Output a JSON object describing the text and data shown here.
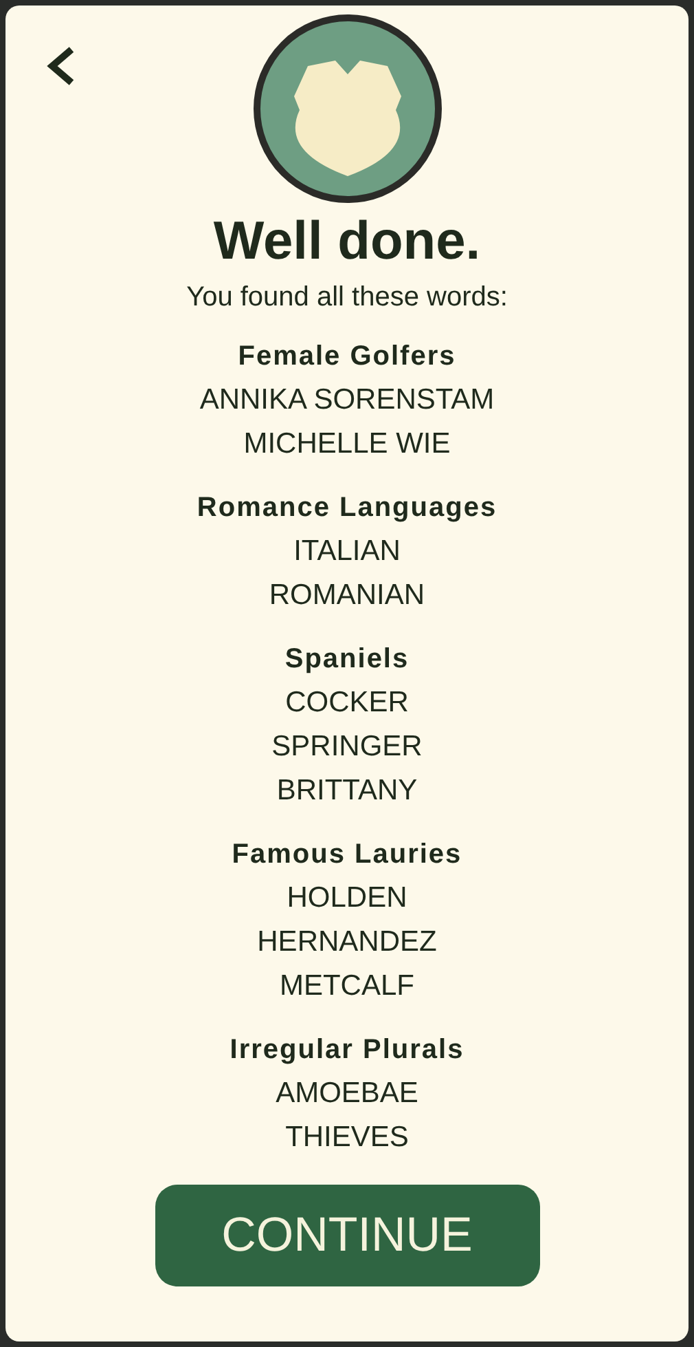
{
  "title": "Well done.",
  "subtitle": "You found all these words:",
  "groups": [
    {
      "category": "Female Golfers",
      "words": [
        "ANNIKA SORENSTAM",
        "MICHELLE WIE"
      ]
    },
    {
      "category": "Romance Languages",
      "words": [
        "ITALIAN",
        "ROMANIAN"
      ]
    },
    {
      "category": "Spaniels",
      "words": [
        "COCKER",
        "SPRINGER",
        "BRITTANY"
      ]
    },
    {
      "category": "Famous Lauries",
      "words": [
        "HOLDEN",
        "HERNANDEZ",
        "METCALF"
      ]
    },
    {
      "category": "Irregular Plurals",
      "words": [
        "AMOEBAE",
        "THIEVES"
      ]
    }
  ],
  "continue_button": {
    "label": "CONTINUE"
  }
}
